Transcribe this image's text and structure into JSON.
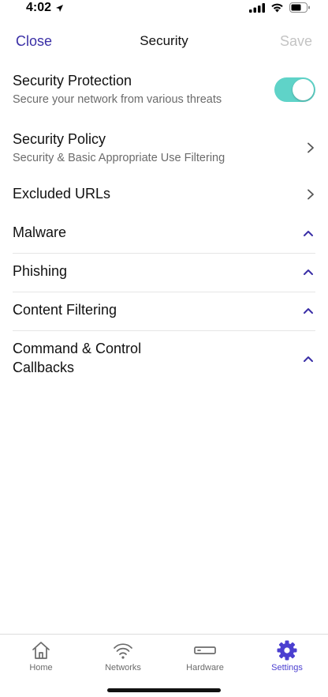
{
  "status_bar": {
    "time": "4:02"
  },
  "nav": {
    "close_label": "Close",
    "title": "Security",
    "save_label": "Save"
  },
  "rows": {
    "protection": {
      "title": "Security Protection",
      "subtitle": "Secure your network from various threats",
      "toggle_on": true
    },
    "policy": {
      "title": "Security Policy",
      "subtitle": "Security & Basic Appropriate Use Filtering"
    },
    "excluded": {
      "title": "Excluded URLs"
    },
    "malware": {
      "title": "Malware"
    },
    "phishing": {
      "title": "Phishing"
    },
    "content_filtering": {
      "title": "Content Filtering"
    },
    "command_control": {
      "title_line1": "Command & Control",
      "title_line2": "Callbacks"
    }
  },
  "tab_bar": {
    "home": "Home",
    "networks": "Networks",
    "hardware": "Hardware",
    "settings": "Settings",
    "active": "settings"
  },
  "colors": {
    "accent": "#3a2fa6",
    "toggle_on": "#5fd3c8",
    "active_tab": "#4b3fd0",
    "disabled": "#c4c4c4"
  }
}
